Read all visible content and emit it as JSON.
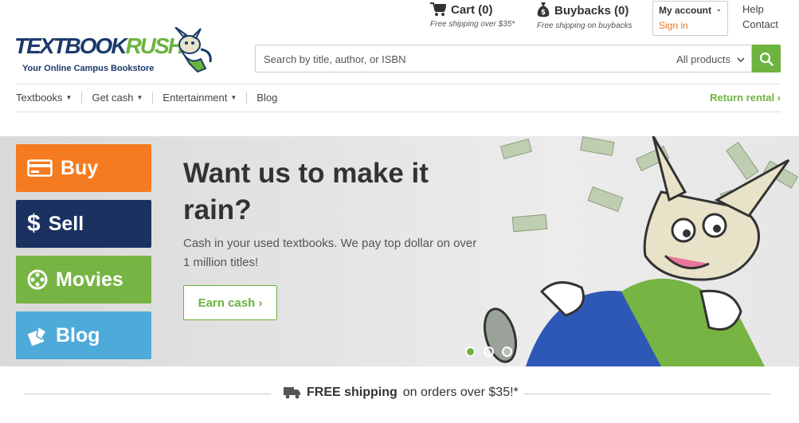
{
  "header": {
    "logo_text_1": "TEXTBOOK",
    "logo_text_2": "RUSH",
    "logo_tagline": "Your Online Campus Bookstore",
    "cart": {
      "label": "Cart (0)",
      "note": "Free shipping over $35*"
    },
    "buybacks": {
      "label": "Buybacks (0)",
      "note": "Free shipping on buybacks"
    },
    "account": {
      "label": "My account",
      "signin": "Sign in"
    },
    "help": "Help",
    "contact": "Contact"
  },
  "search": {
    "placeholder": "Search by title, author, or ISBN",
    "scope": "All products"
  },
  "nav": {
    "items": [
      {
        "label": "Textbooks"
      },
      {
        "label": "Get cash"
      },
      {
        "label": "Entertainment"
      },
      {
        "label": "Blog"
      }
    ],
    "return_rental": "Return rental ›"
  },
  "hero": {
    "categories": [
      {
        "label": "Buy",
        "icon": "credit-card-icon"
      },
      {
        "label": "Sell",
        "icon": "dollar-icon"
      },
      {
        "label": "Movies",
        "icon": "film-reel-icon"
      },
      {
        "label": "Blog",
        "icon": "pencil-paper-icon"
      }
    ],
    "headline": "Want us to make it rain?",
    "body": "Cash in your used textbooks. We pay top dollar on over 1 million titles!",
    "cta": "Earn cash ›",
    "slides_active": 1,
    "slides_total": 3
  },
  "shipping": {
    "bold": "FREE shipping",
    "rest": "on orders over $35!*"
  },
  "colors": {
    "green": "#6db33f",
    "orange": "#f47b20",
    "navy": "#1b3160",
    "blue": "#4eaad8",
    "signin": "#e87722"
  }
}
